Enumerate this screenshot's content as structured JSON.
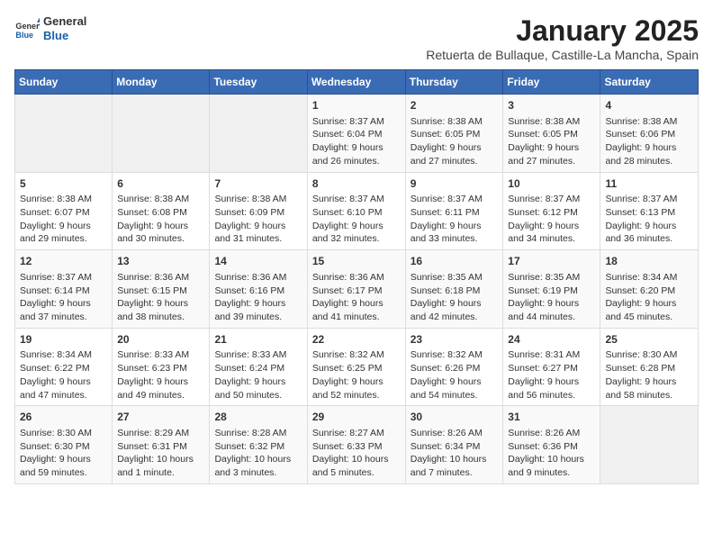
{
  "logo": {
    "line1": "General",
    "line2": "Blue"
  },
  "title": "January 2025",
  "subtitle": "Retuerta de Bullaque, Castille-La Mancha, Spain",
  "weekdays": [
    "Sunday",
    "Monday",
    "Tuesday",
    "Wednesday",
    "Thursday",
    "Friday",
    "Saturday"
  ],
  "weeks": [
    [
      {
        "day": "",
        "info": ""
      },
      {
        "day": "",
        "info": ""
      },
      {
        "day": "",
        "info": ""
      },
      {
        "day": "1",
        "info": "Sunrise: 8:37 AM\nSunset: 6:04 PM\nDaylight: 9 hours\nand 26 minutes."
      },
      {
        "day": "2",
        "info": "Sunrise: 8:38 AM\nSunset: 6:05 PM\nDaylight: 9 hours\nand 27 minutes."
      },
      {
        "day": "3",
        "info": "Sunrise: 8:38 AM\nSunset: 6:05 PM\nDaylight: 9 hours\nand 27 minutes."
      },
      {
        "day": "4",
        "info": "Sunrise: 8:38 AM\nSunset: 6:06 PM\nDaylight: 9 hours\nand 28 minutes."
      }
    ],
    [
      {
        "day": "5",
        "info": "Sunrise: 8:38 AM\nSunset: 6:07 PM\nDaylight: 9 hours\nand 29 minutes."
      },
      {
        "day": "6",
        "info": "Sunrise: 8:38 AM\nSunset: 6:08 PM\nDaylight: 9 hours\nand 30 minutes."
      },
      {
        "day": "7",
        "info": "Sunrise: 8:38 AM\nSunset: 6:09 PM\nDaylight: 9 hours\nand 31 minutes."
      },
      {
        "day": "8",
        "info": "Sunrise: 8:37 AM\nSunset: 6:10 PM\nDaylight: 9 hours\nand 32 minutes."
      },
      {
        "day": "9",
        "info": "Sunrise: 8:37 AM\nSunset: 6:11 PM\nDaylight: 9 hours\nand 33 minutes."
      },
      {
        "day": "10",
        "info": "Sunrise: 8:37 AM\nSunset: 6:12 PM\nDaylight: 9 hours\nand 34 minutes."
      },
      {
        "day": "11",
        "info": "Sunrise: 8:37 AM\nSunset: 6:13 PM\nDaylight: 9 hours\nand 36 minutes."
      }
    ],
    [
      {
        "day": "12",
        "info": "Sunrise: 8:37 AM\nSunset: 6:14 PM\nDaylight: 9 hours\nand 37 minutes."
      },
      {
        "day": "13",
        "info": "Sunrise: 8:36 AM\nSunset: 6:15 PM\nDaylight: 9 hours\nand 38 minutes."
      },
      {
        "day": "14",
        "info": "Sunrise: 8:36 AM\nSunset: 6:16 PM\nDaylight: 9 hours\nand 39 minutes."
      },
      {
        "day": "15",
        "info": "Sunrise: 8:36 AM\nSunset: 6:17 PM\nDaylight: 9 hours\nand 41 minutes."
      },
      {
        "day": "16",
        "info": "Sunrise: 8:35 AM\nSunset: 6:18 PM\nDaylight: 9 hours\nand 42 minutes."
      },
      {
        "day": "17",
        "info": "Sunrise: 8:35 AM\nSunset: 6:19 PM\nDaylight: 9 hours\nand 44 minutes."
      },
      {
        "day": "18",
        "info": "Sunrise: 8:34 AM\nSunset: 6:20 PM\nDaylight: 9 hours\nand 45 minutes."
      }
    ],
    [
      {
        "day": "19",
        "info": "Sunrise: 8:34 AM\nSunset: 6:22 PM\nDaylight: 9 hours\nand 47 minutes."
      },
      {
        "day": "20",
        "info": "Sunrise: 8:33 AM\nSunset: 6:23 PM\nDaylight: 9 hours\nand 49 minutes."
      },
      {
        "day": "21",
        "info": "Sunrise: 8:33 AM\nSunset: 6:24 PM\nDaylight: 9 hours\nand 50 minutes."
      },
      {
        "day": "22",
        "info": "Sunrise: 8:32 AM\nSunset: 6:25 PM\nDaylight: 9 hours\nand 52 minutes."
      },
      {
        "day": "23",
        "info": "Sunrise: 8:32 AM\nSunset: 6:26 PM\nDaylight: 9 hours\nand 54 minutes."
      },
      {
        "day": "24",
        "info": "Sunrise: 8:31 AM\nSunset: 6:27 PM\nDaylight: 9 hours\nand 56 minutes."
      },
      {
        "day": "25",
        "info": "Sunrise: 8:30 AM\nSunset: 6:28 PM\nDaylight: 9 hours\nand 58 minutes."
      }
    ],
    [
      {
        "day": "26",
        "info": "Sunrise: 8:30 AM\nSunset: 6:30 PM\nDaylight: 9 hours\nand 59 minutes."
      },
      {
        "day": "27",
        "info": "Sunrise: 8:29 AM\nSunset: 6:31 PM\nDaylight: 10 hours\nand 1 minute."
      },
      {
        "day": "28",
        "info": "Sunrise: 8:28 AM\nSunset: 6:32 PM\nDaylight: 10 hours\nand 3 minutes."
      },
      {
        "day": "29",
        "info": "Sunrise: 8:27 AM\nSunset: 6:33 PM\nDaylight: 10 hours\nand 5 minutes."
      },
      {
        "day": "30",
        "info": "Sunrise: 8:26 AM\nSunset: 6:34 PM\nDaylight: 10 hours\nand 7 minutes."
      },
      {
        "day": "31",
        "info": "Sunrise: 8:26 AM\nSunset: 6:36 PM\nDaylight: 10 hours\nand 9 minutes."
      },
      {
        "day": "",
        "info": ""
      }
    ]
  ]
}
